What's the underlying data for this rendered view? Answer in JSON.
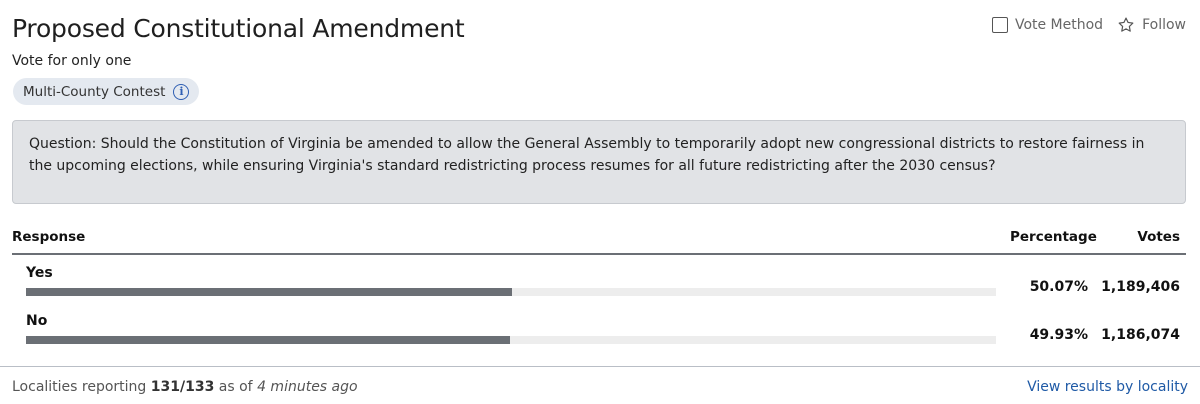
{
  "contest": {
    "title": "Proposed Constitutional Amendment",
    "subtitle": "Vote for only one",
    "badge": "Multi-County Contest",
    "badge_icon": "info-icon"
  },
  "actions": {
    "vote_method_label": "Vote Method",
    "vote_method_icon": "checkbox-icon",
    "follow_label": "Follow",
    "follow_icon": "star-icon"
  },
  "question": "Question: Should the Constitution of Virginia be amended to allow the General Assembly to temporarily adopt new congressional districts to restore fairness in the upcoming elections, while ensuring Virginia's standard redistricting process resumes for all future redistricting after the 2030 census?",
  "table": {
    "headers": {
      "response": "Response",
      "percentage": "Percentage",
      "votes": "Votes"
    },
    "rows": [
      {
        "response": "Yes",
        "percentage": "50.07%",
        "votes": "1,189,406",
        "share": 0.5007
      },
      {
        "response": "No",
        "percentage": "49.93%",
        "votes": "1,186,074",
        "share": 0.4993
      }
    ]
  },
  "footer": {
    "reporting_prefix": "Localities reporting",
    "reporting_count": "131/133",
    "as_of": "as of",
    "time_ago": "4 minutes ago",
    "link": "View results by locality"
  },
  "colors": {
    "bar_fill": "#6b6f75",
    "bar_track": "#ededed",
    "badge_bg": "#e4e9f0",
    "link": "#1f5aa6"
  }
}
